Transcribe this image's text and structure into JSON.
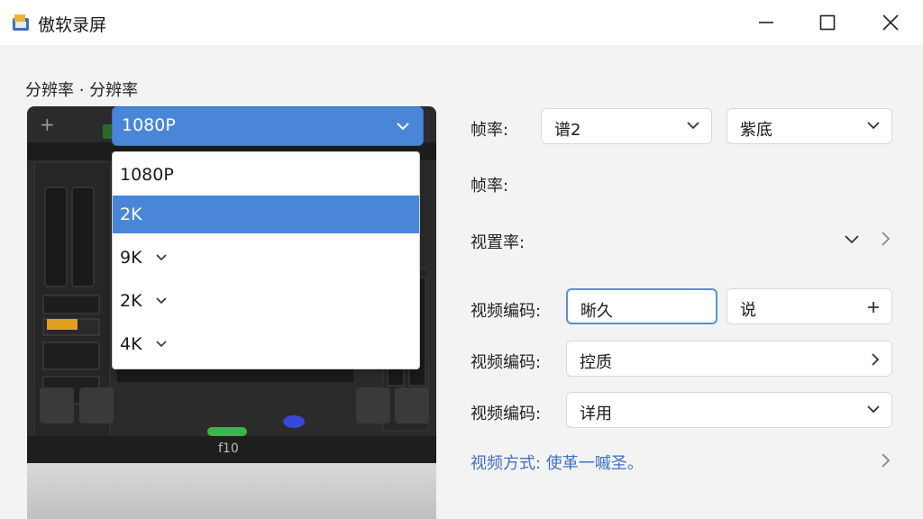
{
  "window": {
    "title": "傲软录屏",
    "minimize_icon": "minimize-icon",
    "maximize_icon": "maximize-icon",
    "close_icon": "close-icon"
  },
  "section": {
    "label": "分辨率 · 分辨率"
  },
  "preview": {
    "add_icon": "+",
    "bottom_label": "f10"
  },
  "resolution": {
    "selected": "1080P",
    "options": [
      {
        "label": "1080P",
        "selected": false,
        "chevron": false
      },
      {
        "label": "2K",
        "selected": true,
        "chevron": false
      },
      {
        "label": "9K",
        "selected": false,
        "chevron": true
      },
      {
        "label": "2K",
        "selected": false,
        "chevron": true
      },
      {
        "label": "4K",
        "selected": false,
        "chevron": true
      }
    ]
  },
  "settings": {
    "framerate_label": "帧率:",
    "framerate_value1": "谱2",
    "framerate_value2": "紫底",
    "framerate2_label": "帧率:",
    "video_rate_label": "视置率:",
    "codec1_label": "视频编码:",
    "codec1_value1": "晰久",
    "codec1_value2": "说",
    "codec2_label": "视频编码:",
    "codec2_value": "控质",
    "codec3_label": "视频编码:",
    "codec3_value": "详用",
    "link_text": "视频方式: 使革一嘁圣。"
  },
  "colors": {
    "accent": "#4a86d8",
    "link": "#3e72c4"
  }
}
